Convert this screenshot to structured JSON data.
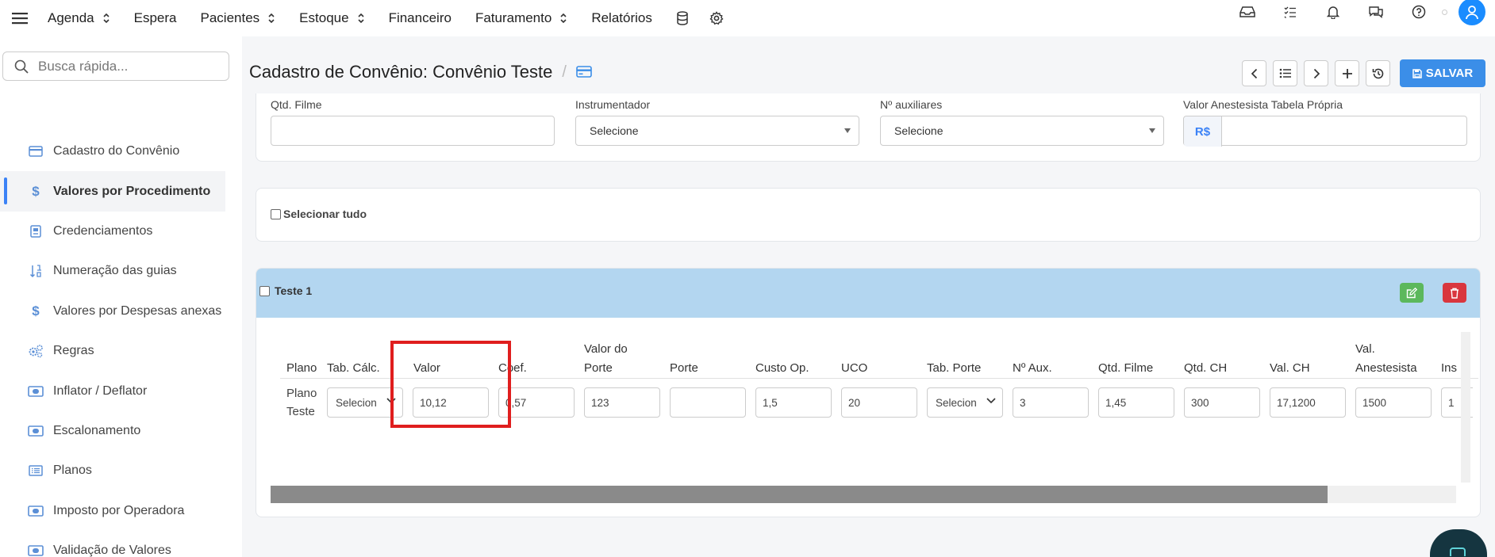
{
  "topnav": {
    "items": [
      {
        "label": "Agenda",
        "has_chevron": true
      },
      {
        "label": "Espera",
        "has_chevron": false
      },
      {
        "label": "Pacientes",
        "has_chevron": true
      },
      {
        "label": "Estoque",
        "has_chevron": true
      },
      {
        "label": "Financeiro",
        "has_chevron": false
      },
      {
        "label": "Faturamento",
        "has_chevron": true
      },
      {
        "label": "Relatórios",
        "has_chevron": false
      }
    ],
    "icons": [
      "database-icon",
      "gear-icon"
    ],
    "right_icons": [
      "inbox-icon",
      "checklist-icon",
      "bell-icon",
      "chat-icon",
      "help-icon",
      "avatar-icon"
    ]
  },
  "sidebar": {
    "search_placeholder": "Busca rápida...",
    "items": [
      {
        "label": "Cadastro do Convênio",
        "icon": "card-icon",
        "active": false
      },
      {
        "label": "Valores por Procedimento",
        "icon": "dollar-icon",
        "active": true
      },
      {
        "label": "Credenciamentos",
        "icon": "id-badge-icon",
        "active": false
      },
      {
        "label": "Numeração das guias",
        "icon": "sort-numeric-icon",
        "active": false
      },
      {
        "label": "Valores por Despesas anexas",
        "icon": "dollar-icon",
        "active": false
      },
      {
        "label": "Regras",
        "icon": "cogs-icon",
        "active": false
      },
      {
        "label": "Inflator / Deflator",
        "icon": "money-icon",
        "active": false
      },
      {
        "label": "Escalonamento",
        "icon": "money-icon",
        "active": false
      },
      {
        "label": "Planos",
        "icon": "list-icon",
        "active": false
      },
      {
        "label": "Imposto por Operadora",
        "icon": "money-icon",
        "active": false
      },
      {
        "label": "Validação de Valores",
        "icon": "money-icon",
        "active": false
      }
    ]
  },
  "header": {
    "title": "Cadastro de Convênio: Convênio Teste",
    "separator": "/",
    "save_label": "SALVAR"
  },
  "form": {
    "qtd_filme_label": "Qtd. Filme",
    "qtd_filme_value": "",
    "instrumentador_label": "Instrumentador",
    "instrumentador_value": "Selecione",
    "auxiliares_label": "Nº auxiliares",
    "auxiliares_value": "Selecione",
    "anestesista_label": "Valor Anestesista Tabela Própria",
    "currency": "R$",
    "anestesista_value": ""
  },
  "select_all_label": "Selecionar tudo",
  "group": {
    "name": "Teste 1",
    "colors": {
      "header_bg": "#b3d6f0",
      "edit": "#5cb85c",
      "delete": "#d9363e"
    }
  },
  "table": {
    "headers": [
      {
        "l1": "",
        "l2": "Plano"
      },
      {
        "l1": "",
        "l2": "Tab. Cálc."
      },
      {
        "l1": "",
        "l2": "Valor"
      },
      {
        "l1": "",
        "l2": "Coef."
      },
      {
        "l1": "Valor do",
        "l2": "Porte"
      },
      {
        "l1": "",
        "l2": "Porte"
      },
      {
        "l1": "",
        "l2": "Custo Op."
      },
      {
        "l1": "",
        "l2": "UCO"
      },
      {
        "l1": "",
        "l2": "Tab. Porte"
      },
      {
        "l1": "",
        "l2": "Nº Aux."
      },
      {
        "l1": "",
        "l2": "Qtd. Filme"
      },
      {
        "l1": "",
        "l2": "Qtd. CH"
      },
      {
        "l1": "",
        "l2": "Val. CH"
      },
      {
        "l1": "Val.",
        "l2": "Anestesista"
      },
      {
        "l1": "",
        "l2": "Ins"
      }
    ],
    "row": {
      "plano_l1": "Plano",
      "plano_l2": "Teste",
      "tab_calc": "Selecion",
      "valor": "10,12",
      "coef": "0,57",
      "valor_porte": "123",
      "porte": "",
      "custo_op": "1,5",
      "uco": "20",
      "tab_porte": "Selecion",
      "n_aux": "3",
      "qtd_filme": "1,45",
      "qtd_ch": "300",
      "val_ch": "17,1200",
      "val_anestesista": "1500",
      "ins": "1"
    }
  },
  "accent": "#3b8ee8",
  "highlight_color": "#e01e1e"
}
